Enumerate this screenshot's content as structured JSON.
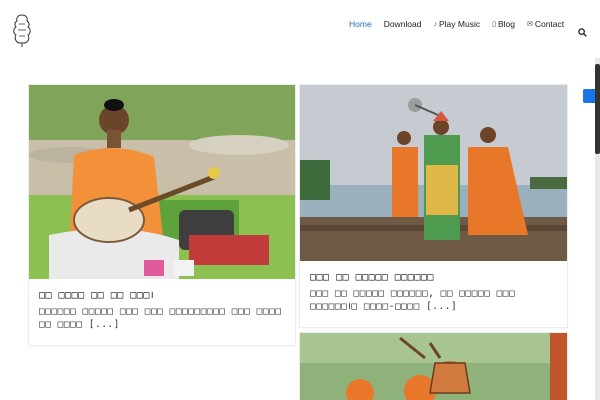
{
  "nav": {
    "items": [
      {
        "label": "Home",
        "icon": ""
      },
      {
        "label": "Download",
        "icon": ""
      },
      {
        "label": "Play Music",
        "icon": "music-icon"
      },
      {
        "label": "Blog",
        "icon": "document-icon"
      },
      {
        "label": "Contact",
        "icon": "mail-icon"
      }
    ],
    "active_color": "#1e73be"
  },
  "posts": [
    {
      "title": "□□ □□□□ □□ □□ □□□।",
      "excerpt": "□□□□□□ □□□□□ □□□ □□□ □□□□□□□□□ □□□ □□□□ □□ □□□□",
      "more": "[...]"
    },
    {
      "title": "□□□ □□ □□□□□ □□□□□□",
      "excerpt": "□□□ □□ □□□□□ □□□□□□, □□ □□□□□ □□□ □□□□□□।□ □□□□-□□□□",
      "more": "[...]"
    }
  ],
  "colors": {
    "accent": "#1e73be",
    "floating_button": "#1a73e8"
  }
}
